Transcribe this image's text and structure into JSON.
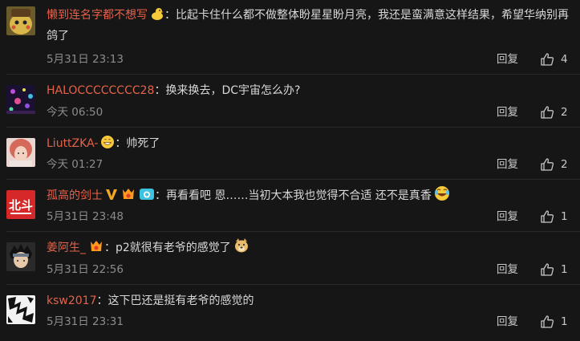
{
  "comments": [
    {
      "username": "懒到连名字都不想写",
      "content": "比起卡住什么都不做整体盼星星盼月亮，我还是蛮满意这样结果，希望华纳别再鸽了",
      "time": "5月31日 23:13",
      "reply_label": "回复",
      "likes": "4",
      "badges": [
        "duck-emoji"
      ]
    },
    {
      "username": "HALOCCCCCCCC28",
      "content": "换来换去，DC宇宙怎么办?",
      "time": "今天 06:50",
      "reply_label": "回复",
      "likes": "2",
      "badges": []
    },
    {
      "username": "LiuttZKA-",
      "content": "帅死了",
      "time": "今天 01:27",
      "reply_label": "回复",
      "likes": "2",
      "badges": [
        "grin-emoji"
      ]
    },
    {
      "username": "孤高的剑士",
      "content": "再看看吧 恩……当初大本我也觉得不合适 还不是真香",
      "time": "5月31日 23:48",
      "reply_label": "回复",
      "likes": "1",
      "badges": [
        "v-verified-badge",
        "vip-badge",
        "camera-badge"
      ],
      "trailing_emoji": "laugh-cry-emoji"
    },
    {
      "username": "姜阿生_",
      "content": "p2就很有老爷的感觉了",
      "time": "5月31日 22:56",
      "reply_label": "回复",
      "likes": "1",
      "badges": [
        "vip-badge"
      ],
      "trailing_emoji": "doge-emoji"
    },
    {
      "username": "ksw2017",
      "content": "这下巴还是挺有老爷的感觉的",
      "time": "5月31日 23:31",
      "reply_label": "回复",
      "likes": "1",
      "badges": []
    }
  ],
  "colors": {
    "background": "#161616",
    "username": "#e5624a",
    "text": "#d8d8d8",
    "meta": "#8c8c8c",
    "accent_badge": "#ff9a1f"
  },
  "avatar_names": [
    "pikachu-detective-avatar",
    "neon-lights-avatar",
    "girl-photo-avatar",
    "beidou-logo-avatar",
    "naruto-character-avatar",
    "black-white-pattern-avatar"
  ]
}
